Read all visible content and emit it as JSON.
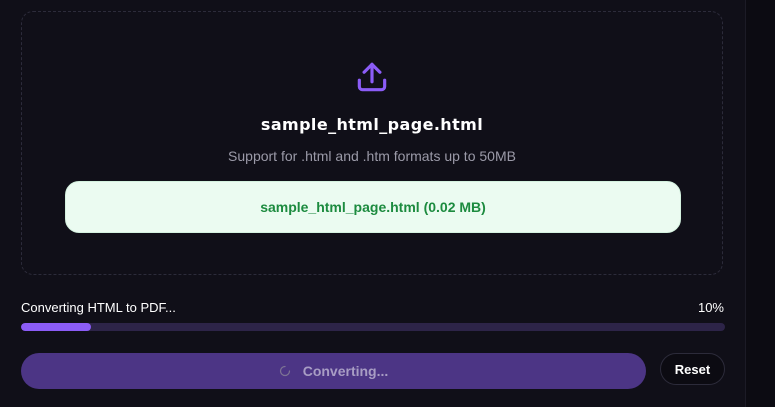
{
  "upload": {
    "icon": "upload-icon",
    "file_title": "sample_html_page.html",
    "support_text": "Support for .html and .htm formats up to 50MB",
    "selected_file": "sample_html_page.html (0.02 MB)"
  },
  "progress": {
    "label": "Converting HTML to PDF...",
    "percent_text": "10%",
    "value": 0.1
  },
  "actions": {
    "convert_label": "Converting...",
    "convert_icon": "spinner-icon",
    "reset_label": "Reset"
  },
  "colors": {
    "accent": "#8b5cf6",
    "success_text": "#1c8b3f",
    "success_bg": "#ebfbf1",
    "background": "#100f18"
  }
}
